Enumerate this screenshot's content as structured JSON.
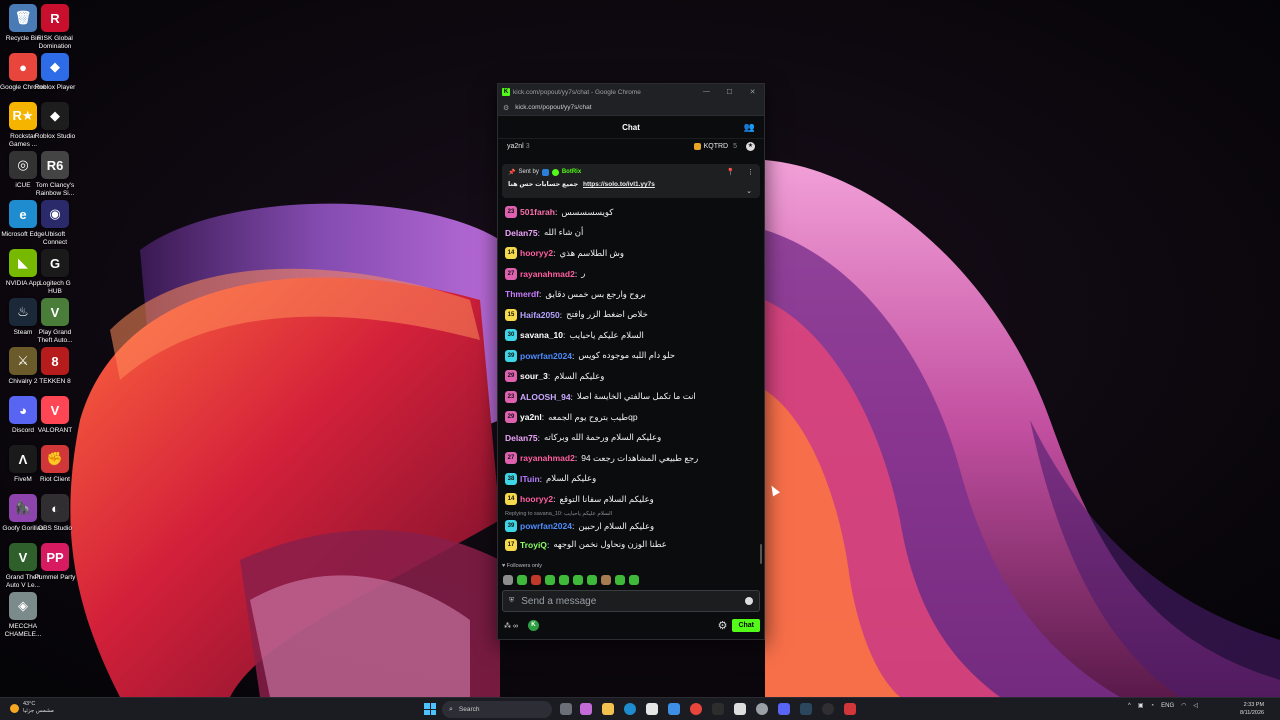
{
  "desktop_icons": [
    {
      "label": "Recycle Bin",
      "glyph": "🗑",
      "color": "#4a7bb5"
    },
    {
      "label": "RISK Global Domination",
      "glyph": "R",
      "color": "#c8102e"
    },
    {
      "label": "Google Chrome",
      "glyph": "●",
      "color": "#e8453c"
    },
    {
      "label": "Roblox Player",
      "glyph": "◆",
      "color": "#2e6be6"
    },
    {
      "label": "Rockstar Games ...",
      "glyph": "R★",
      "color": "#f4b400"
    },
    {
      "label": "Roblox Studio",
      "glyph": "◆",
      "color": "#1d1d1d"
    },
    {
      "label": "iCUE",
      "glyph": "◎",
      "color": "#333333"
    },
    {
      "label": "Tom Clancy's Rainbow Si...",
      "glyph": "R6",
      "color": "#444444"
    },
    {
      "label": "Microsoft Edge",
      "glyph": "e",
      "color": "#1f8ccf"
    },
    {
      "label": "Ubisoft Connect",
      "glyph": "◉",
      "color": "#2a2a6a"
    },
    {
      "label": "NVIDIA App",
      "glyph": "◣",
      "color": "#76b900"
    },
    {
      "label": "Logitech G HUB",
      "glyph": "G",
      "color": "#1a1a1a"
    },
    {
      "label": "Steam",
      "glyph": "♨",
      "color": "#1b2838"
    },
    {
      "label": "Play Grand Theft Auto...",
      "glyph": "V",
      "color": "#4a7d3a"
    },
    {
      "label": "Chivalry 2",
      "glyph": "⚔",
      "color": "#6b5a2a"
    },
    {
      "label": "TEKKEN 8",
      "glyph": "8",
      "color": "#b71c1c"
    },
    {
      "label": "Discord",
      "glyph": "◕",
      "color": "#5865f2"
    },
    {
      "label": "VALORANT",
      "glyph": "V",
      "color": "#ff4655"
    },
    {
      "label": "FiveM",
      "glyph": "Λ",
      "color": "#1a1a1a"
    },
    {
      "label": "Riot Client",
      "glyph": "✊",
      "color": "#d13639"
    },
    {
      "label": "Goofy Gorillas",
      "glyph": "🦍",
      "color": "#8e44ad"
    },
    {
      "label": "OBS Studio",
      "glyph": "◐",
      "color": "#302e31"
    },
    {
      "label": "Grand Theft Auto V Le...",
      "glyph": "V",
      "color": "#2f5f2a"
    },
    {
      "label": "Pummel Party",
      "glyph": "PP",
      "color": "#d81b60"
    },
    {
      "label": "MECCHA CHAMELE...",
      "glyph": "◈",
      "color": "#7b8a8b"
    }
  ],
  "window": {
    "title": "kick.com/popout/yy7s/chat - Google Chrome",
    "url": "kick.com/popout/yy7s/chat",
    "controls": [
      "—",
      "☐",
      "✕"
    ]
  },
  "chat": {
    "header": "Chat",
    "top_user": "ya2nl",
    "top_user_count": "3",
    "top_right_user": "KQTRD",
    "top_right_count": "5",
    "pinned": {
      "sent_by": "Sent by",
      "bot_name": "BotRix",
      "text": "جميع حسابات حس هنا",
      "link": "https://solo.to/ivl1.yy7s"
    },
    "messages": [
      {
        "badge": "23",
        "badge_color": "#e060b0",
        "user": "501farah",
        "user_color": "#ff6fae",
        "text": "كويسسسسس"
      },
      {
        "badge": "",
        "badge_color": "",
        "user": "Delan75",
        "user_color": "#f0a5ff",
        "text": "أن شاء الله"
      },
      {
        "badge": "14",
        "badge_color": "#f5d94a",
        "user": "hooryy2",
        "user_color": "#ff5fa2",
        "text": "وش الطلاسم هذي"
      },
      {
        "badge": "27",
        "badge_color": "#e060b0",
        "user": "rayanahmad2",
        "user_color": "#ff5fa2",
        "text": "ر"
      },
      {
        "badge": "",
        "badge_color": "",
        "user": "Thmerdf",
        "user_color": "#c77dff",
        "text": "بروح وارجع بس خمس دقايق"
      },
      {
        "badge": "15",
        "badge_color": "#f5d94a",
        "user": "Haifa2050",
        "user_color": "#b7a4ff",
        "text": "خلاص اضغط الزر وافتح"
      },
      {
        "badge": "30",
        "badge_color": "#3ed6e6",
        "user": "savana_10",
        "user_color": "#ffffff",
        "text": "السلام عليكم ياحبايب"
      },
      {
        "badge": "39",
        "badge_color": "#3ed6e6",
        "user": "powrfan2024",
        "user_color": "#4d8cff",
        "text": "حلو دام اللبه موجوده كويس"
      },
      {
        "badge": "29",
        "badge_color": "#e060b0",
        "user": "sour_3",
        "user_color": "#ffffff",
        "text": "وعليكم السلام"
      },
      {
        "badge": "23",
        "badge_color": "#e060b0",
        "user": "ALOOSH_94",
        "user_color": "#c9a8ff",
        "text": "انت ما تكمل سالفتي الخايسة اصلا"
      },
      {
        "badge": "29",
        "badge_color": "#e060b0",
        "user": "ya2nl",
        "user_color": "#ffffff",
        "text": "طيب بتروح يوم الجمعهqp"
      },
      {
        "badge": "",
        "badge_color": "",
        "user": "Delan75",
        "user_color": "#f0a5ff",
        "text": "وعليكم السلام ورحمة الله وبركاته"
      },
      {
        "badge": "27",
        "badge_color": "#e060b0",
        "user": "rayanahmad2",
        "user_color": "#ff5fa2",
        "text": "رجع طبيعي المشاهدات رجعت 94"
      },
      {
        "badge": "38",
        "badge_color": "#3ed6e6",
        "user": "ITuin",
        "user_color": "#b57bff",
        "text": "وعليكم السلام"
      },
      {
        "badge": "14",
        "badge_color": "#f5d94a",
        "user": "hooryy2",
        "user_color": "#ff5fa2",
        "text": "وعليكم السلام سفانا التوقع"
      },
      {
        "badge": "39",
        "badge_color": "#3ed6e6",
        "user": "powrfan2024",
        "user_color": "#4d8cff",
        "text": "وعليكم السلام ارحبين"
      },
      {
        "badge": "17",
        "badge_color": "#f5d94a",
        "user": "TroyiQ",
        "user_color": "#8cff6a",
        "text": "عطنا الوزن ونحاول نخمن الوجهه"
      }
    ],
    "reply_hint": "Replying to savana_10: السلام عليكم ياحبايب",
    "followers_only": "Followers only",
    "input_placeholder": "Send a message",
    "send_button": "Chat"
  },
  "taskbar": {
    "weather_temp": "43°C",
    "weather_desc": "مشمس جزئيا",
    "search_label": "Search",
    "language": "ENG",
    "time": "2:33 PM",
    "date": "8/11/2026"
  },
  "colors": {
    "kick_green": "#53fc18",
    "window_bg": "#0b0c0d"
  }
}
